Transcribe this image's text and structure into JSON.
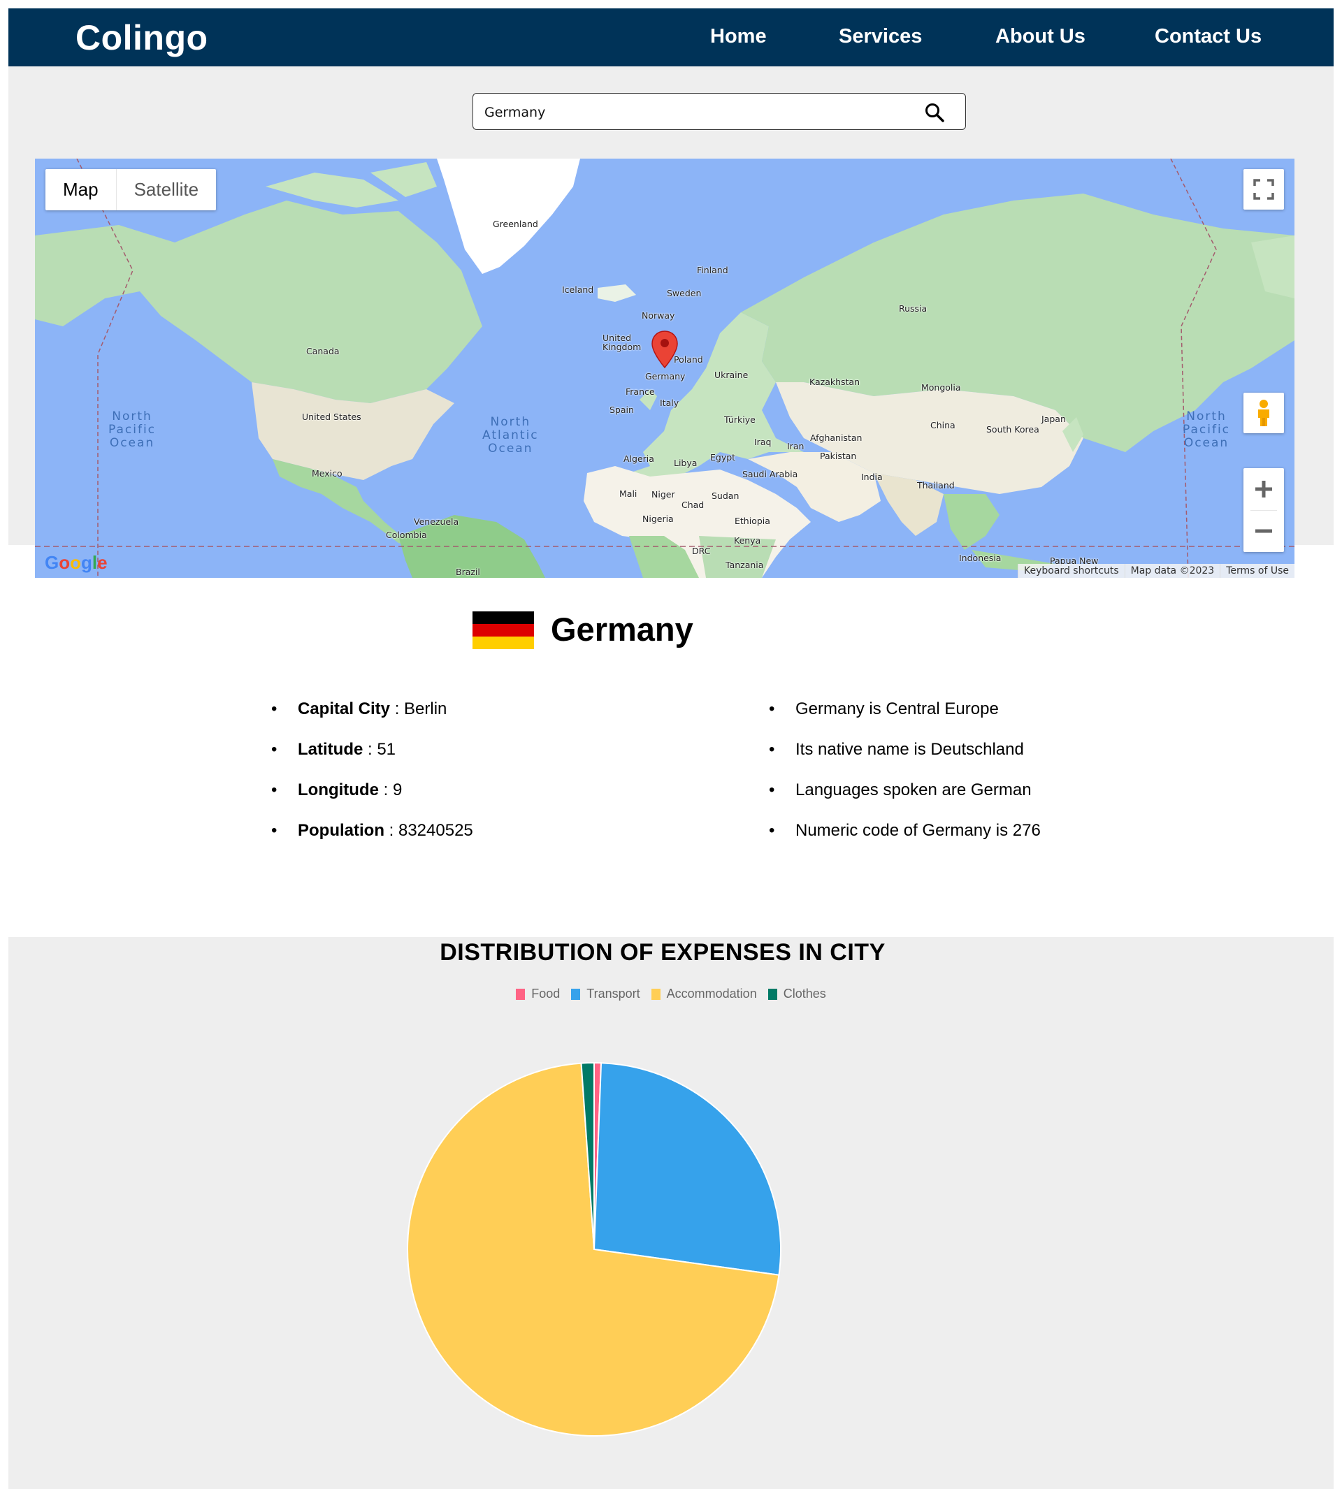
{
  "header": {
    "brand": "Colingo",
    "nav": [
      "Home",
      "Services",
      "About Us",
      "Contact Us"
    ]
  },
  "search": {
    "value": "Germany"
  },
  "map": {
    "type_map": "Map",
    "type_satellite": "Satellite",
    "logo": "Google",
    "attribution": [
      "Keyboard shortcuts",
      "Map data ©2023",
      "Terms of Use"
    ],
    "labels": {
      "greenland": "Greenland",
      "iceland": "Iceland",
      "finland": "Finland",
      "sweden": "Sweden",
      "norway": "Norway",
      "uk": "United\nKingdom",
      "poland": "Poland",
      "germany": "Germany",
      "ukraine": "Ukraine",
      "france": "France",
      "italy": "Italy",
      "spain": "Spain",
      "russia": "Russia",
      "kazakhstan": "Kazakhstan",
      "mongolia": "Mongolia",
      "china": "China",
      "turkiye": "Türkiye",
      "iraq": "Iraq",
      "iran": "Iran",
      "afghanistan": "Afghanistan",
      "pakistan": "Pakistan",
      "india": "India",
      "japan": "Japan",
      "south_korea": "South Korea",
      "thailand": "Thailand",
      "algeria": "Algeria",
      "libya": "Libya",
      "egypt": "Egypt",
      "saudi_arabia": "Saudi Arabia",
      "mali": "Mali",
      "niger": "Niger",
      "chad": "Chad",
      "sudan": "Sudan",
      "nigeria": "Nigeria",
      "ethiopia": "Ethiopia",
      "kenya": "Kenya",
      "drc": "DRC",
      "tanzania": "Tanzania",
      "indonesia": "Indonesia",
      "papua": "Papua New",
      "canada": "Canada",
      "united_states": "United States",
      "mexico": "Mexico",
      "venezuela": "Venezuela",
      "colombia": "Colombia",
      "brazil": "Brazil",
      "n_pacific_left": "North\nPacific\nOcean",
      "n_atlantic": "North\nAtlantic\nOcean",
      "n_pacific_right": "North\nPacific\nOcean"
    },
    "marker_country": "Germany"
  },
  "country": {
    "name": "Germany",
    "flag_colors": [
      "#000000",
      "#DD0000",
      "#FFCE00"
    ],
    "facts_left": [
      {
        "label": "Capital City",
        "value": " : Berlin"
      },
      {
        "label": "Latitude",
        "value": " : 51"
      },
      {
        "label": "Longitude",
        "value": " : 9"
      },
      {
        "label": "Population",
        "value": " : 83240525"
      }
    ],
    "facts_right": [
      "Germany is Central Europe",
      "Its native name is Deutschland",
      "Languages spoken are German",
      "Numeric code of Germany is 276"
    ]
  },
  "chart_data": {
    "type": "pie",
    "title": "DISTRIBUTION OF EXPENSES IN CITY",
    "legend_position": "top",
    "categories": [
      "Food",
      "Transport",
      "Accommodation",
      "Clothes"
    ],
    "values": [
      0.6,
      26.6,
      71.7,
      1.1
    ],
    "colors": [
      "#FF6384",
      "#36A2EB",
      "#FFCE56",
      "#007A66"
    ]
  }
}
